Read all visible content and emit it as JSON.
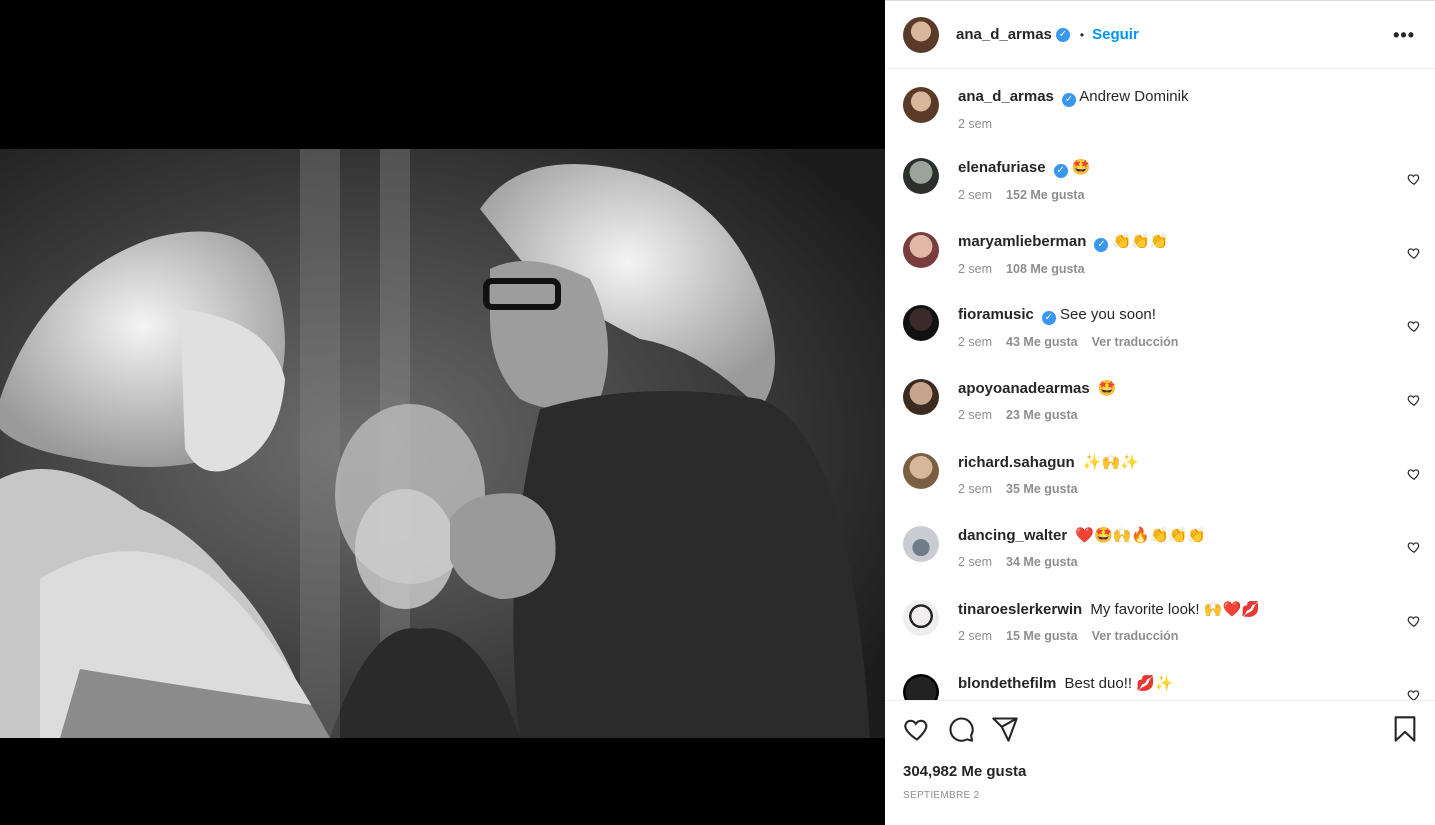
{
  "post": {
    "author": "ana_d_armas",
    "follow_label": "Seguir",
    "separator": "•",
    "more_label": "•••",
    "caption": {
      "user": "ana_d_armas",
      "text": "Andrew Dominik",
      "time": "2 sem"
    },
    "likes": "304,982 Me gusta",
    "date": "SEPTIEMBRE 2"
  },
  "comments": [
    {
      "user": "elenafuriase",
      "verified": true,
      "text": "🤩",
      "time": "2 sem",
      "likes": "152 Me gusta",
      "translate": ""
    },
    {
      "user": "maryamlieberman",
      "verified": true,
      "text": "👏👏👏",
      "time": "2 sem",
      "likes": "108 Me gusta",
      "translate": ""
    },
    {
      "user": "fioramusic",
      "verified": true,
      "text": "See you soon!",
      "time": "2 sem",
      "likes": "43 Me gusta",
      "translate": "Ver traducción"
    },
    {
      "user": "apoyoanadearmas",
      "verified": false,
      "text": "🤩",
      "time": "2 sem",
      "likes": "23 Me gusta",
      "translate": ""
    },
    {
      "user": "richard.sahagun",
      "verified": false,
      "text": "✨🙌✨",
      "time": "2 sem",
      "likes": "35 Me gusta",
      "translate": ""
    },
    {
      "user": "dancing_walter",
      "verified": false,
      "text": "❤️🤩🙌🔥👏👏👏",
      "time": "2 sem",
      "likes": "34 Me gusta",
      "translate": ""
    },
    {
      "user": "tinaroeslerkerwin",
      "verified": false,
      "text": "My favorite look! 🙌❤️💋",
      "time": "2 sem",
      "likes": "15 Me gusta",
      "translate": "Ver traducción"
    },
    {
      "user": "blondethefilm",
      "verified": false,
      "text": "Best duo!! 💋✨",
      "time": "",
      "likes": "",
      "translate": ""
    }
  ],
  "icons": [
    "like-icon",
    "comment-icon",
    "share-icon",
    "save-icon",
    "verified-icon",
    "more-icon"
  ],
  "colors": {
    "link": "#0095f6",
    "verified": "#3897f0",
    "muted": "#8e8e8e",
    "text": "#262626"
  }
}
